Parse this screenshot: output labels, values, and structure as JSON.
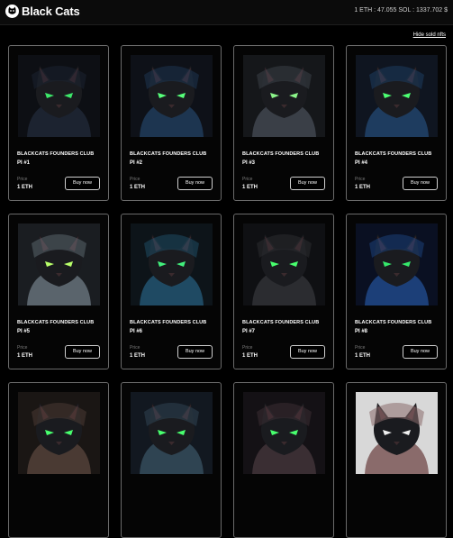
{
  "header": {
    "brand": "Black Cats",
    "rate": "1 ETH : 47.055 SOL : 1337.702 $"
  },
  "filter": {
    "hide_sold_label": "Hide sold nfts"
  },
  "card_common": {
    "collection": "BLACKCATS FOUNDERS CLUB",
    "price_label": "Price",
    "price": "1 ETH",
    "buy_label": "Buy now"
  },
  "cards": [
    {
      "token": "PI #1",
      "hood": "#1c2330",
      "eye": "#3de86a",
      "bg": "#0d0f14"
    },
    {
      "token": "PI #2",
      "hood": "#1d3550",
      "eye": "#57ff7a",
      "bg": "#0e1118"
    },
    {
      "token": "PI #3",
      "hood": "#3a3f47",
      "eye": "#8cf58a",
      "bg": "#15171a"
    },
    {
      "token": "PI #4",
      "hood": "#1e3c5f",
      "eye": "#4cff72",
      "bg": "#0f1520"
    },
    {
      "token": "PI #5",
      "hood": "#5a646c",
      "eye": "#b8ff6a",
      "bg": "#1a1d21"
    },
    {
      "token": "PI #6",
      "hood": "#1f4a63",
      "eye": "#42f07c",
      "bg": "#0d1419"
    },
    {
      "token": "PI #7",
      "hood": "#2b2c30",
      "eye": "#48ff6e",
      "bg": "#0f1013"
    },
    {
      "token": "PI #8",
      "hood": "#1c3f78",
      "eye": "#35e86b",
      "bg": "#0a1022"
    },
    {
      "token": "",
      "hood": "#4a3a33",
      "eye": "#48ff6e",
      "bg": "#1a1614"
    },
    {
      "token": "",
      "hood": "#2f4452",
      "eye": "#48ff6e",
      "bg": "#121820"
    },
    {
      "token": "",
      "hood": "#3a2e33",
      "eye": "#48ff6e",
      "bg": "#141115"
    },
    {
      "token": "",
      "hood": "#8a6b6b",
      "eye": "#f0f0f0",
      "bg": "#d8d8d8"
    }
  ]
}
